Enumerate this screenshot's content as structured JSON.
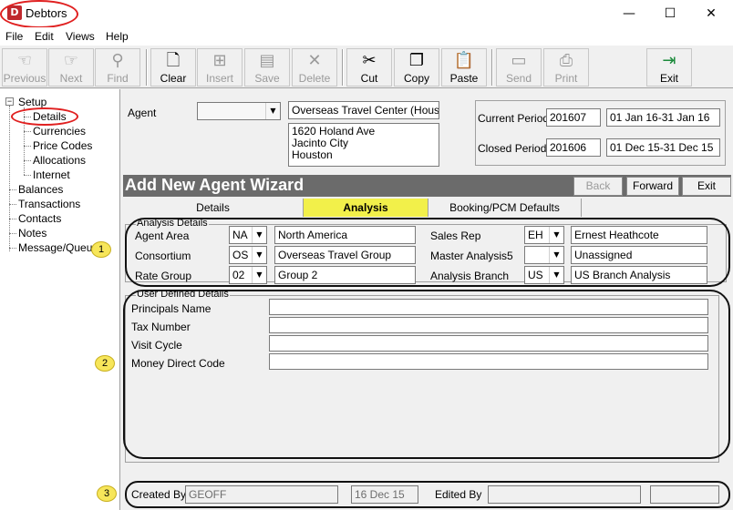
{
  "window": {
    "title": "Debtors",
    "icon_letter": "D",
    "minimize": "—",
    "maximize": "☐",
    "close": "✕"
  },
  "menu": [
    "File",
    "Edit",
    "Views",
    "Help"
  ],
  "toolbar": {
    "previous": "Previous",
    "next": "Next",
    "find": "Find",
    "clear": "Clear",
    "insert": "Insert",
    "save": "Save",
    "delete": "Delete",
    "cut": "Cut",
    "copy": "Copy",
    "paste": "Paste",
    "send": "Send",
    "print": "Print",
    "exit": "Exit"
  },
  "tree": {
    "setup": "Setup",
    "details": "Details",
    "currencies": "Currencies",
    "price_codes": "Price Codes",
    "allocations": "Allocations",
    "internet": "Internet",
    "balances": "Balances",
    "transactions": "Transactions",
    "contacts": "Contacts",
    "notes": "Notes",
    "message_queue": "Message/Queue"
  },
  "agent": {
    "label": "Agent",
    "code": "",
    "name": "Overseas Travel Center (Houston)",
    "address": [
      "1620 Holand Ave",
      "Jacinto City",
      "Houston"
    ]
  },
  "period": {
    "current_label": "Current Period",
    "current_value": "201607",
    "current_range": "01 Jan 16-31 Jan 16",
    "closed_label": "Closed Period",
    "closed_value": "201606",
    "closed_range": "01 Dec 15-31 Dec 15"
  },
  "wizard": {
    "title": "Add New Agent Wizard",
    "back": "Back",
    "forward": "Forward",
    "exit": "Exit"
  },
  "tabs": [
    "Details",
    "Analysis",
    "Booking/PCM Defaults"
  ],
  "analysis": {
    "title": "Analysis Details",
    "agent_area_label": "Agent Area",
    "agent_area_code": "NA",
    "agent_area_desc": "North America",
    "consortium_label": "Consortium",
    "consortium_code": "OS",
    "consortium_desc": "Overseas Travel Group",
    "rate_group_label": "Rate Group",
    "rate_group_code": "02",
    "rate_group_desc": "Group 2",
    "sales_rep_label": "Sales Rep",
    "sales_rep_code": "EH",
    "sales_rep_desc": "Ernest Heathcote",
    "master5_label": "Master Analysis5",
    "master5_code": "",
    "master5_desc": "Unassigned",
    "branch_label": "Analysis Branch",
    "branch_code": "US",
    "branch_desc": "US Branch Analysis"
  },
  "user_defined": {
    "title": "User Defined Details",
    "principals_label": "Principals Name",
    "principals_value": "",
    "tax_label": "Tax Number",
    "tax_value": "",
    "visit_label": "Visit Cycle",
    "visit_value": "",
    "money_label": "Money Direct Code",
    "money_value": ""
  },
  "footer": {
    "created_label": "Created By",
    "created_by": "GEOFF",
    "created_date": "16 Dec 15",
    "edited_label": "Edited By",
    "edited_by": "",
    "edited_date": ""
  },
  "badges": [
    "1",
    "2",
    "3"
  ]
}
